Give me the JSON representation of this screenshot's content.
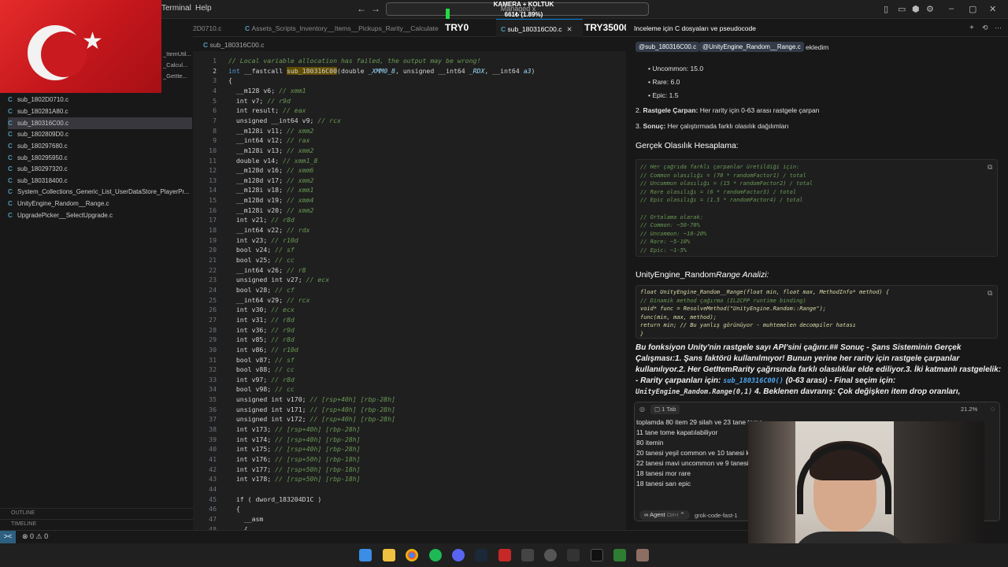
{
  "titlebar": {
    "menu_terminal": "Terminal",
    "menu_help": "Help",
    "command_center": "Managed x",
    "stream_title": "KAMERA + KOLTUK",
    "stream_amount": "661₺ (1.89%)"
  },
  "overlays": {
    "try0": "TRY0",
    "try35000": "TRY35000"
  },
  "tabs": [
    {
      "label": "2D0710.c"
    },
    {
      "label": "Assets_Scripts_Inventory__Items__Pickups_Rarity__CalculateRarity"
    },
    {
      "label": "sub_180316C00.c"
    },
    {
      "label": "Inceleme için C dosyaları ve pseudocode"
    }
  ],
  "breadcrumb": "sub_180316C00.c",
  "sidebar": {
    "partial_items": [
      "_ItemUtil...",
      "_Calcul...",
      "_GetIte..."
    ],
    "files": [
      {
        "name": "sub_1802D0710.c",
        "active": false
      },
      {
        "name": "sub_180281A80.c",
        "active": false
      },
      {
        "name": "sub_180316C00.c",
        "active": true
      },
      {
        "name": "sub_1802809D0.c",
        "active": false
      },
      {
        "name": "sub_180297680.c",
        "active": false
      },
      {
        "name": "sub_180295950.c",
        "active": false
      },
      {
        "name": "sub_180297320.c",
        "active": false
      },
      {
        "name": "sub_180318400.c",
        "active": false
      },
      {
        "name": "System_Collections_Generic_List_UserDataStore_PlayerPr...",
        "active": false
      },
      {
        "name": "UnityEngine_Random__Range.c",
        "active": false
      },
      {
        "name": "UpgradePicker__SelectUpgrade.c",
        "active": false
      }
    ],
    "outline": "OUTLINE",
    "timeline": "TIMELINE"
  },
  "statusbar": {
    "remote": "><",
    "problems": "⊗ 0 ⚠ 0"
  },
  "editor": {
    "lines": [
      {
        "n": "1",
        "segs": [
          {
            "t": "// Local variable allocation has failed, the output may be wrong!",
            "c": "cm"
          }
        ]
      },
      {
        "n": "2",
        "segs": [
          {
            "t": "int ",
            "c": "kw"
          },
          {
            "t": "__fastcall "
          },
          {
            "t": "sub_180316C00",
            "c": "hl"
          },
          {
            "t": "(double "
          },
          {
            "t": "_XMM0_8",
            "c": "ital"
          },
          {
            "t": ", unsigned __int64 "
          },
          {
            "t": "_RDX",
            "c": "ital"
          },
          {
            "t": ", __int64 "
          },
          {
            "t": "a3",
            "c": "ital"
          },
          {
            "t": ")"
          }
        ]
      },
      {
        "n": "3",
        "segs": [
          {
            "t": "{"
          }
        ]
      },
      {
        "n": "4",
        "segs": [
          {
            "t": "  __m128 v6; "
          },
          {
            "t": "// xmm1",
            "c": "cm"
          }
        ]
      },
      {
        "n": "5",
        "segs": [
          {
            "t": "  int v7; "
          },
          {
            "t": "// r9d",
            "c": "cm"
          }
        ]
      },
      {
        "n": "6",
        "segs": [
          {
            "t": "  int result; "
          },
          {
            "t": "// eax",
            "c": "cm"
          }
        ]
      },
      {
        "n": "7",
        "segs": [
          {
            "t": "  unsigned __int64 v9; "
          },
          {
            "t": "// rcx",
            "c": "cm"
          }
        ]
      },
      {
        "n": "8",
        "segs": [
          {
            "t": "  __m128i v11; "
          },
          {
            "t": "// xmm2",
            "c": "cm"
          }
        ]
      },
      {
        "n": "9",
        "segs": [
          {
            "t": "  __int64 v12; "
          },
          {
            "t": "// rax",
            "c": "cm"
          }
        ]
      },
      {
        "n": "10",
        "segs": [
          {
            "t": "  __m128i v13; "
          },
          {
            "t": "// xmm2",
            "c": "cm"
          }
        ]
      },
      {
        "n": "11",
        "segs": [
          {
            "t": "  double v14; "
          },
          {
            "t": "// xmm1_8",
            "c": "cm"
          }
        ]
      },
      {
        "n": "12",
        "segs": [
          {
            "t": "  __m128d v16; "
          },
          {
            "t": "// xmm6",
            "c": "cm"
          }
        ]
      },
      {
        "n": "13",
        "segs": [
          {
            "t": "  __m128d v17; "
          },
          {
            "t": "// xmm2",
            "c": "cm"
          }
        ]
      },
      {
        "n": "14",
        "segs": [
          {
            "t": "  __m128i v18; "
          },
          {
            "t": "// xmm1",
            "c": "cm"
          }
        ]
      },
      {
        "n": "15",
        "segs": [
          {
            "t": "  __m128d v19; "
          },
          {
            "t": "// xmm4",
            "c": "cm"
          }
        ]
      },
      {
        "n": "16",
        "segs": [
          {
            "t": "  __m128i v20; "
          },
          {
            "t": "// xmm2",
            "c": "cm"
          }
        ]
      },
      {
        "n": "17",
        "segs": [
          {
            "t": "  int v21; "
          },
          {
            "t": "// r8d",
            "c": "cm"
          }
        ]
      },
      {
        "n": "18",
        "segs": [
          {
            "t": "  __int64 v22; "
          },
          {
            "t": "// rdx",
            "c": "cm"
          }
        ]
      },
      {
        "n": "19",
        "segs": [
          {
            "t": "  int v23; "
          },
          {
            "t": "// r10d",
            "c": "cm"
          }
        ]
      },
      {
        "n": "20",
        "segs": [
          {
            "t": "  bool v24; "
          },
          {
            "t": "// sf",
            "c": "cm"
          }
        ]
      },
      {
        "n": "21",
        "segs": [
          {
            "t": "  bool v25; "
          },
          {
            "t": "// cc",
            "c": "cm"
          }
        ]
      },
      {
        "n": "22",
        "segs": [
          {
            "t": "  __int64 v26; "
          },
          {
            "t": "// r8",
            "c": "cm"
          }
        ]
      },
      {
        "n": "23",
        "segs": [
          {
            "t": "  unsigned int v27; "
          },
          {
            "t": "// ecx",
            "c": "cm"
          }
        ]
      },
      {
        "n": "24",
        "segs": [
          {
            "t": "  bool v28; "
          },
          {
            "t": "// cf",
            "c": "cm"
          }
        ]
      },
      {
        "n": "25",
        "segs": [
          {
            "t": "  __int64 v29; "
          },
          {
            "t": "// rcx",
            "c": "cm"
          }
        ]
      },
      {
        "n": "26",
        "segs": [
          {
            "t": "  int v30; "
          },
          {
            "t": "// ecx",
            "c": "cm"
          }
        ]
      },
      {
        "n": "27",
        "segs": [
          {
            "t": "  int v31; "
          },
          {
            "t": "// r8d",
            "c": "cm"
          }
        ]
      },
      {
        "n": "28",
        "segs": [
          {
            "t": "  int v36; "
          },
          {
            "t": "// r9d",
            "c": "cm"
          }
        ]
      },
      {
        "n": "29",
        "segs": [
          {
            "t": "  int v85; "
          },
          {
            "t": "// r8d",
            "c": "cm"
          }
        ]
      },
      {
        "n": "30",
        "segs": [
          {
            "t": "  int v86; "
          },
          {
            "t": "// r10d",
            "c": "cm"
          }
        ]
      },
      {
        "n": "31",
        "segs": [
          {
            "t": "  bool v87; "
          },
          {
            "t": "// sf",
            "c": "cm"
          }
        ]
      },
      {
        "n": "32",
        "segs": [
          {
            "t": "  bool v88; "
          },
          {
            "t": "// cc",
            "c": "cm"
          }
        ]
      },
      {
        "n": "33",
        "segs": [
          {
            "t": "  int v97; "
          },
          {
            "t": "// r8d",
            "c": "cm"
          }
        ]
      },
      {
        "n": "34",
        "segs": [
          {
            "t": "  bool v98; "
          },
          {
            "t": "// cc",
            "c": "cm"
          }
        ]
      },
      {
        "n": "35",
        "segs": [
          {
            "t": "  unsigned int v170; "
          },
          {
            "t": "// [rsp+40h] [rbp-28h]",
            "c": "cm"
          }
        ]
      },
      {
        "n": "36",
        "segs": [
          {
            "t": "  unsigned int v171; "
          },
          {
            "t": "// [rsp+40h] [rbp-28h]",
            "c": "cm"
          }
        ]
      },
      {
        "n": "37",
        "segs": [
          {
            "t": "  unsigned int v172; "
          },
          {
            "t": "// [rsp+40h] [rbp-28h]",
            "c": "cm"
          }
        ]
      },
      {
        "n": "38",
        "segs": [
          {
            "t": "  int v173; "
          },
          {
            "t": "// [rsp+40h] [rbp-28h]",
            "c": "cm"
          }
        ]
      },
      {
        "n": "39",
        "segs": [
          {
            "t": "  int v174; "
          },
          {
            "t": "// [rsp+40h] [rbp-28h]",
            "c": "cm"
          }
        ]
      },
      {
        "n": "40",
        "segs": [
          {
            "t": "  int v175; "
          },
          {
            "t": "// [rsp+40h] [rbp-28h]",
            "c": "cm"
          }
        ]
      },
      {
        "n": "41",
        "segs": [
          {
            "t": "  int v176; "
          },
          {
            "t": "// [rsp+50h] [rbp-18h]",
            "c": "cm"
          }
        ]
      },
      {
        "n": "42",
        "segs": [
          {
            "t": "  int v177; "
          },
          {
            "t": "// [rsp+50h] [rbp-18h]",
            "c": "cm"
          }
        ]
      },
      {
        "n": "43",
        "segs": [
          {
            "t": "  int v178; "
          },
          {
            "t": "// [rsp+50h] [rbp-18h]",
            "c": "cm"
          }
        ]
      },
      {
        "n": "44",
        "segs": [
          {
            "t": ""
          }
        ]
      },
      {
        "n": "45",
        "segs": [
          {
            "t": "  if ( dword_183204D1C )"
          }
        ]
      },
      {
        "n": "46",
        "segs": [
          {
            "t": "  {"
          }
        ]
      },
      {
        "n": "47",
        "segs": [
          {
            "t": "    __asm"
          }
        ]
      },
      {
        "n": "48",
        "segs": [
          {
            "t": "    {"
          }
        ]
      }
    ]
  },
  "chat": {
    "title": "Inceleme için C dosyaları ve pseudocode",
    "chips": [
      "@sub_180316C00.c",
      "@UnityEngine_Random__Range.c"
    ],
    "chips_suffix": "ekledim",
    "bullets": [
      "Uncommon: 15.0",
      "Rare: 6.0",
      "Epic: 1.5"
    ],
    "numbered": [
      {
        "num": "2.",
        "bold": "Rastgele Çarpan:",
        "rest": " Her rarity için 0-63 arası rastgele çarpan"
      },
      {
        "num": "3.",
        "bold": "Sonuç:",
        "rest": " Her çalıştırmada farklı olasılık dağılımları"
      }
    ],
    "heading1": "Gerçek Olasılık Hesaplama:",
    "code1": [
      "// Her çağrıda farklı çarpanlar üretildiği için:",
      "// Common olasılığı = (70 * randomFactor1) / total",
      "// Uncommon olasılığı = (15 * randomFactor2) / total",
      "// Rare olasılığı = (6 * randomFactor3) / total",
      "// Epic olasılığı = (1.5 * randomFactor4) / total",
      "",
      "// Ortalama olarak:",
      "// Common: ~50-70%",
      "// Uncommon: ~10-20%",
      "// Rare: ~5-10%",
      "// Epic: ~1-5%"
    ],
    "heading2": "UnityEngine_Random",
    "heading2_italic": "Range Analizi:",
    "code2": [
      "float UnityEngine_Random__Range(float min, float max, MethodInfo* method) {",
      "    // Dinamik method çağırma (IL2CPP runtime binding)",
      "    void* func = ResolveMethod(\"UnityEngine.Random::Range\");",
      "    func(min, max, method);",
      "    return min; // Bu yanlış görünüyor - muhtemelen decompiler hatası",
      "}"
    ],
    "answer_part1": "Bu fonksiyon Unity'nin rastgele sayı API'sini çağırır.## Sonuç - Şans Sisteminin Gerçek Çalışması:1. Şans faktörü kullanılmıyor! Bunun yerine her rarity için rastgele çarpanlar kullanılıyor.2. Her GetItemRarity çağrısında farklı olasılıklar elde ediliyor.3. İki katmanlı rastgelelik: - Rarity çarpanları için: ",
    "answer_code1": "sub_180316C00()",
    "answer_part2": " (0-63 arası) - Final seçim için: ",
    "answer_code2": "UnityEngine_Random.Range(0,1)",
    "answer_part3": " 4. Beklenen davranış: Çok değişken item drop oranları,",
    "tab_count": "1 Tab",
    "percent": "21.2%"
  },
  "input": {
    "lines": [
      "toplamda 80 item 29 silah ve 23 tane tome",
      "11 tane tome kapatılabiliyor",
      "80 itemin",
      "20 tanesi yeşil common ve 10 tanesi kapatılabiliyor",
      "22 tanesi mavi uncommon ve 9 tanesi kapatılabiliyor",
      "18 tanesi mor rare",
      "18 tanesi sarı epic"
    ],
    "mode": "Agent",
    "mode_shortcut": "Ctrl+I",
    "model": "grok-code-fast-1"
  },
  "colors": {
    "accent": "#0078d4",
    "editor_bg": "#1f1f1f",
    "sidebar_bg": "#181818",
    "highlight": "#614d00"
  }
}
